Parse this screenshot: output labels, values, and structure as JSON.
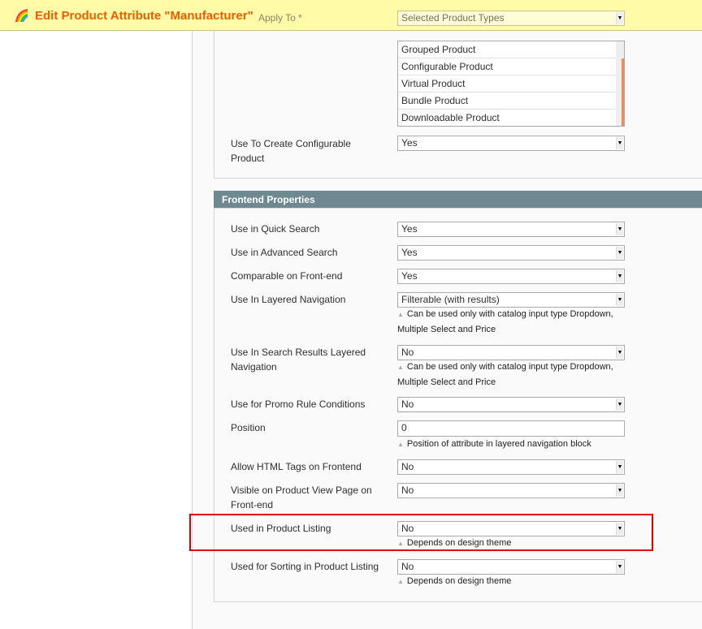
{
  "header": {
    "title": "Edit Product Attribute \"Manufacturer\"",
    "icon": "rainbow-icon"
  },
  "apply_to": {
    "label": "Apply To *",
    "value": "Selected Product Types",
    "options": [
      "Grouped Product",
      "Configurable Product",
      "Virtual Product",
      "Bundle Product",
      "Downloadable Product"
    ]
  },
  "configurable": {
    "label": "Use To Create Configurable Product",
    "value": "Yes"
  },
  "frontend": {
    "title": "Frontend Properties",
    "rows": [
      {
        "label": "Use in Quick Search",
        "value": "Yes"
      },
      {
        "label": "Use in Advanced Search",
        "value": "Yes"
      },
      {
        "label": "Comparable on Front-end",
        "value": "Yes"
      },
      {
        "label": "Use In Layered Navigation",
        "value": "Filterable (with results)",
        "note": "Can be used only with catalog input type Dropdown, Multiple Select and Price"
      },
      {
        "label": "Use In Search Results Layered Navigation",
        "value": "No",
        "note": "Can be used only with catalog input type Dropdown, Multiple Select and Price"
      },
      {
        "label": "Use for Promo Rule Conditions",
        "value": "No"
      },
      {
        "label": "Position",
        "value": "0",
        "note": "Position of attribute in layered navigation block"
      },
      {
        "label": "Allow HTML Tags on Frontend",
        "value": "No"
      },
      {
        "label": "Visible on Product View Page on Front-end",
        "value": "No"
      },
      {
        "label": "Used in Product Listing",
        "value": "No",
        "note": "Depends on design theme"
      },
      {
        "label": "Used for Sorting in Product Listing",
        "value": "No",
        "note": "Depends on design theme"
      }
    ]
  },
  "colors": {
    "accent": "#eb5e00",
    "section_header": "#6f8992",
    "highlight": "#e00000"
  }
}
